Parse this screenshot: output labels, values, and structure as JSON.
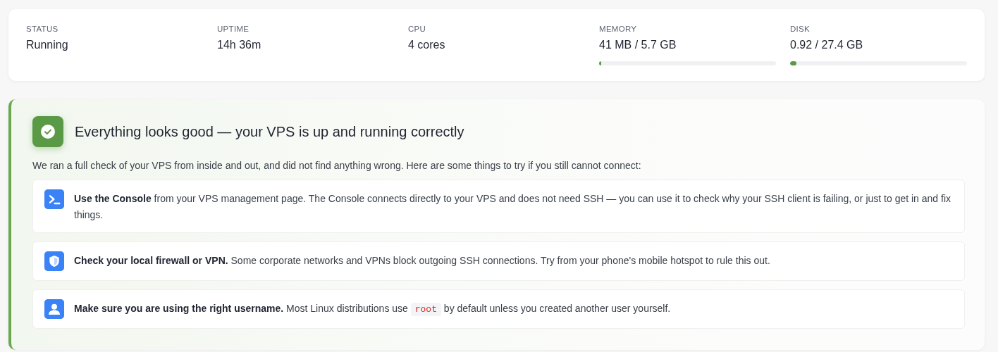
{
  "stats": [
    {
      "label": "STATUS",
      "value": "Running"
    },
    {
      "label": "UPTIME",
      "value": "14h 36m"
    },
    {
      "label": "CPU",
      "value": "4 cores"
    },
    {
      "label": "MEMORY",
      "value": "41 MB / 5.7 GB",
      "level": 0.005
    },
    {
      "label": "DISK",
      "value": "0.92 / 27.4 GB",
      "level": 0.034
    }
  ],
  "health": {
    "title": "Everything looks good — your VPS is up and running correctly",
    "intro": "We ran a full check of your VPS from inside and out, and did not find anything wrong. Here are some things to try if you still cannot connect:",
    "tips": [
      {
        "kind": "console",
        "text": "**Use the Console** from your VPS management page. The Console connects directly to your VPS and does not need SSH — you can use it to check why your SSH client is failing, or just to get in and fix things."
      },
      {
        "kind": "shield",
        "text": "**Check your local firewall or VPN.** Some corporate networks and VPNs block outgoing SSH connections. Try from your phone's mobile hotspot to rule this out."
      },
      {
        "kind": "user",
        "text": "**Make sure you are using the right username.** Most Linux distributions use ",
        "code": "root",
        "text_after": " by default unless you created another user yourself."
      }
    ]
  }
}
